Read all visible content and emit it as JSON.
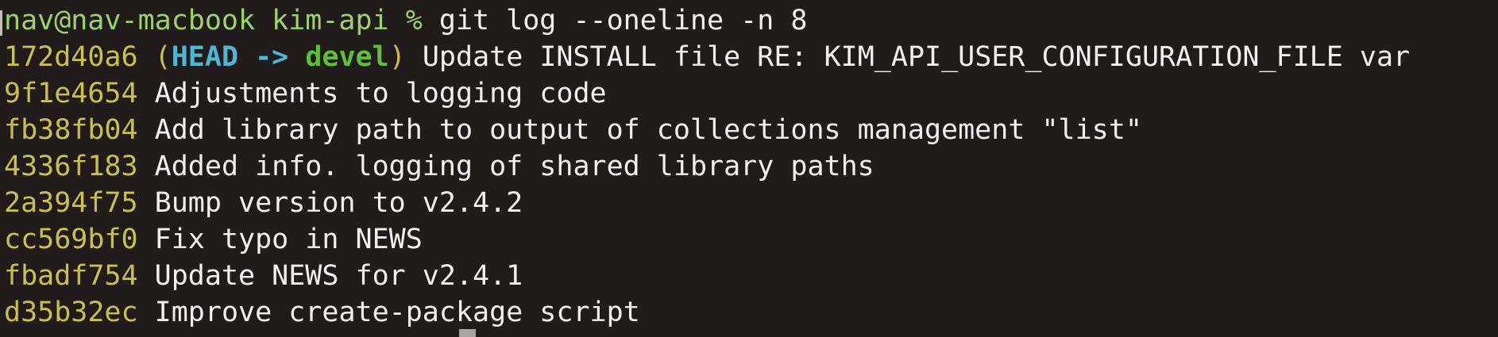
{
  "terminal": {
    "prompt": "nav@nav-macbook kim-api % ",
    "command": "git log --oneline -n 8",
    "commits": [
      {
        "hash": "172d40a6",
        "refs": {
          "open": "(",
          "head": "HEAD",
          "arrow": "->",
          "branch": "devel",
          "close": ")"
        },
        "message": "Update INSTALL file RE: KIM_API_USER_CONFIGURATION_FILE var"
      },
      {
        "hash": "9f1e4654",
        "message": "Adjustments to logging code"
      },
      {
        "hash": "fb38fb04",
        "message": "Add library path to output of collections management \"list\""
      },
      {
        "hash": "4336f183",
        "message": "Added info. logging of shared library paths"
      },
      {
        "hash": "2a394f75",
        "message": "Bump version to v2.4.2"
      },
      {
        "hash": "cc569bf0",
        "message": "Fix typo in NEWS"
      },
      {
        "hash": "fbadf754",
        "message": "Update NEWS for v2.4.1"
      },
      {
        "hash": "d35b32ec",
        "message": "Improve create-package script"
      }
    ]
  },
  "colors": {
    "background": "#221b1c",
    "prompt": "#9bd36c",
    "hash": "#c9bf52",
    "head": "#4fb6d4",
    "branch": "#5fbf3a",
    "text": "#f1eff0"
  }
}
